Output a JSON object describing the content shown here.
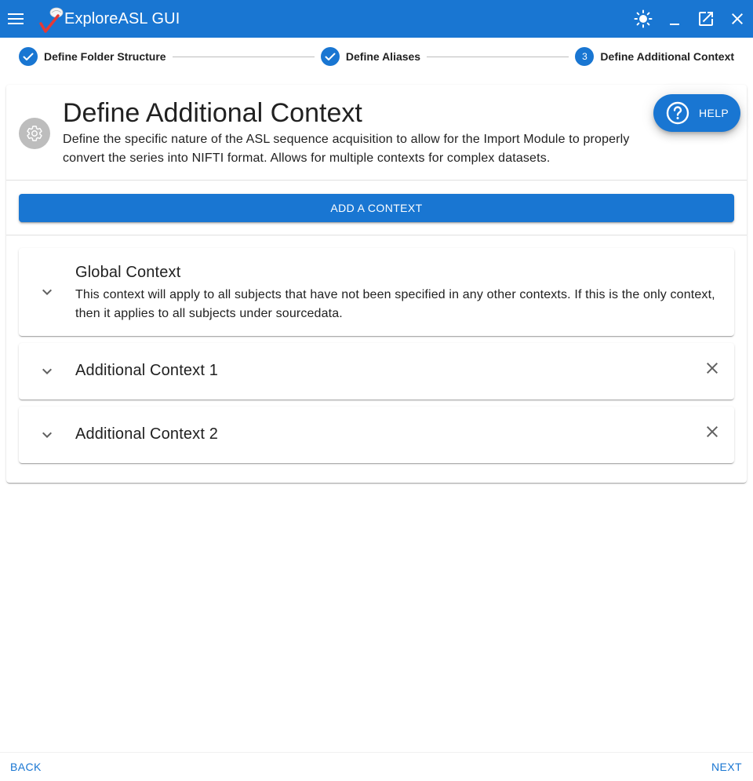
{
  "app": {
    "title": "ExploreASL GUI",
    "icons": {
      "menu": "menu-icon",
      "theme": "brightness-icon",
      "minimize": "minimize-icon",
      "maximize": "open-in-new-icon",
      "close": "close-icon"
    }
  },
  "stepper": {
    "steps": [
      {
        "label": "Define Folder Structure",
        "state": "completed"
      },
      {
        "label": "Define Aliases",
        "state": "completed"
      },
      {
        "label": "Define Additional Context",
        "state": "active",
        "number": "3"
      }
    ]
  },
  "header": {
    "title": "Define Additional Context",
    "description": "Define the specific nature of the ASL sequence acquisition to allow for the Import Module to properly convert the series into NIFTI format. Allows for multiple contexts for complex datasets.",
    "help_label": "HELP"
  },
  "actions": {
    "add_context_label": "ADD A CONTEXT"
  },
  "contexts": [
    {
      "title": "Global Context",
      "description": "This context will apply to all subjects that have not been specified in any other contexts. If this is the only context, then it applies to all subjects under sourcedata.",
      "removable": false
    },
    {
      "title": "Additional Context 1",
      "removable": true
    },
    {
      "title": "Additional Context 2",
      "removable": true
    }
  ],
  "footer": {
    "back_label": "BACK",
    "next_label": "NEXT"
  },
  "colors": {
    "primary": "#1976d2",
    "text": "#212121",
    "muted_icon": "#616161",
    "avatar_bg": "#bdbdbd",
    "logo_check": "#e53935"
  }
}
